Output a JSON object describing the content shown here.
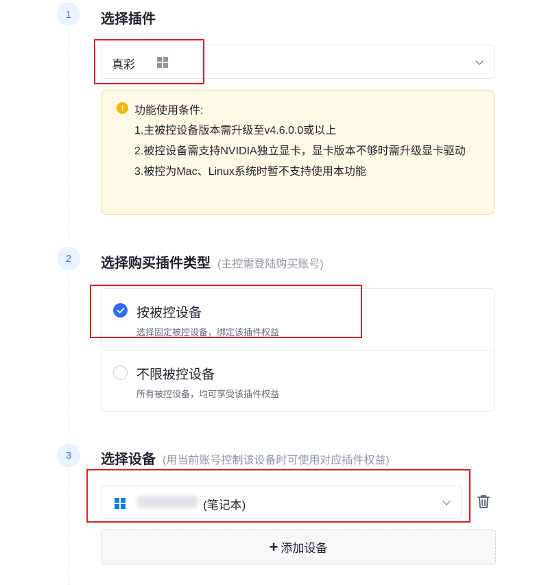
{
  "steps": [
    {
      "number": "1",
      "title": "选择插件",
      "hint": ""
    },
    {
      "number": "2",
      "title": "选择购买插件类型",
      "hint": "(主控需登陆购买账号)"
    },
    {
      "number": "3",
      "title": "选择设备",
      "hint": "(用当前账号控制该设备时可使用对应插件权益)"
    }
  ],
  "plugin_select": {
    "value": "真彩",
    "platform_icon": "windows-icon"
  },
  "notice": {
    "title": "功能使用条件:",
    "lines": [
      "1.主被控设备版本需升级至v4.6.0.0或以上",
      "2.被控设备需支持NVIDIA独立显卡，显卡版本不够时需升级显卡驱动",
      "3.被控为Mac、Linux系统时暂不支持使用本功能"
    ]
  },
  "purchase_types": [
    {
      "title": "按被控设备",
      "desc": "选择固定被控设备，绑定该插件权益",
      "selected": true
    },
    {
      "title": "不限被控设备",
      "desc": "所有被控设备，均可享受该插件权益",
      "selected": false
    }
  ],
  "device_select": {
    "suffix": "(笔记本)",
    "platform_icon": "windows-icon"
  },
  "add_device_label": "添加设备",
  "colors": {
    "accent": "#2b6ff5",
    "highlight": "#d9202a",
    "notice_bg": "#fff9e6",
    "windows_blue": "#0a7ae6"
  }
}
